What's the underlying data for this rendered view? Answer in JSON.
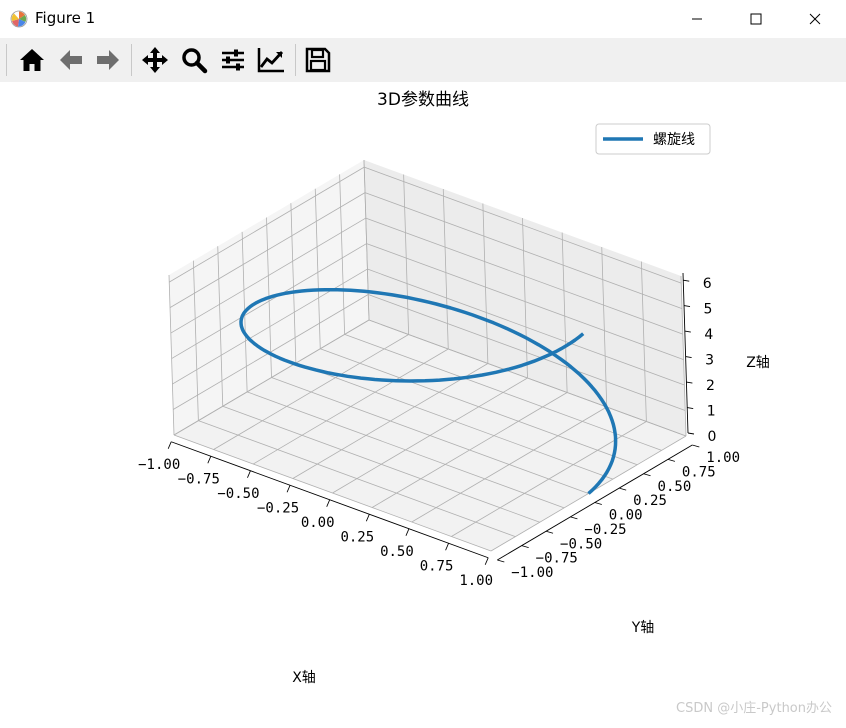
{
  "window": {
    "title": "Figure 1"
  },
  "toolbar": {
    "buttons": [
      {
        "name": "home-icon"
      },
      {
        "name": "back-arrow-icon"
      },
      {
        "name": "forward-arrow-icon"
      },
      {
        "name": "pan-icon"
      },
      {
        "name": "zoom-icon"
      },
      {
        "name": "configure-subplots-icon"
      },
      {
        "name": "edit-axis-icon"
      },
      {
        "name": "save-icon"
      }
    ]
  },
  "chart_data": {
    "type": "line",
    "projection": "3d",
    "title": "3D参数曲线",
    "xlabel": "X轴",
    "ylabel": "Y轴",
    "zlabel": "Z轴",
    "xlim": [
      -1.0,
      1.0
    ],
    "ylim": [
      -1.0,
      1.0
    ],
    "zlim": [
      0,
      6.28
    ],
    "x_ticks": [
      "−1.00",
      "−0.75",
      "−0.50",
      "−0.25",
      "0.00",
      "0.25",
      "0.50",
      "0.75",
      "1.00"
    ],
    "y_ticks": [
      "−1.00",
      "−0.75",
      "−0.50",
      "−0.25",
      "0.00",
      "0.25",
      "0.50",
      "0.75",
      "1.00"
    ],
    "z_ticks": [
      "0",
      "1",
      "2",
      "3",
      "4",
      "5",
      "6"
    ],
    "grid": true,
    "legend_position": "top-right",
    "series": [
      {
        "name": "螺旋线",
        "color": "#1f77b4",
        "parametric": "x=cos(t), y=sin(t), z=t",
        "t_range": [
          0,
          6.28
        ]
      }
    ]
  },
  "watermark": "CSDN @小庄-Python办公"
}
